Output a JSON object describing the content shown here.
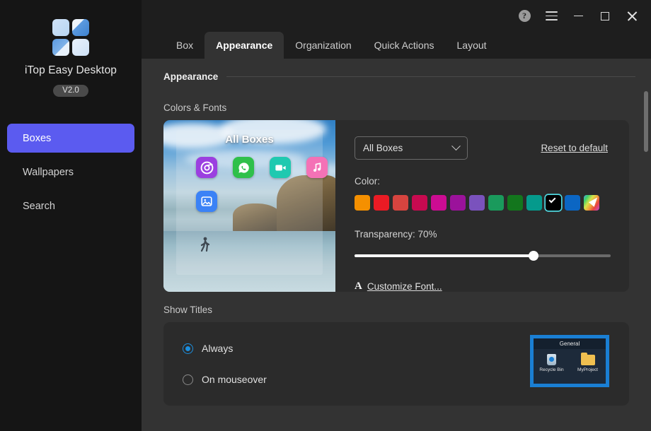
{
  "sidebar": {
    "app_name": "iTop Easy Desktop",
    "version": "V2.0",
    "logo_icon": "four-squares-logo-icon",
    "items": [
      {
        "label": "Boxes",
        "active": true
      },
      {
        "label": "Wallpapers",
        "active": false
      },
      {
        "label": "Search",
        "active": false
      }
    ]
  },
  "titlebar": {
    "help_label": "?",
    "help_icon": "help-circle-icon",
    "menu_icon": "hamburger-menu-icon",
    "minimize_icon": "minimize-icon",
    "maximize_icon": "maximize-icon",
    "close_icon": "close-icon"
  },
  "tabs": [
    {
      "label": "Box",
      "active": false
    },
    {
      "label": "Appearance",
      "active": true
    },
    {
      "label": "Organization",
      "active": false
    },
    {
      "label": "Quick Actions",
      "active": false
    },
    {
      "label": "Layout",
      "active": false
    }
  ],
  "content": {
    "section_title": "Appearance",
    "groups": {
      "colors_fonts": "Colors & Fonts",
      "show_titles": "Show Titles"
    }
  },
  "preview": {
    "box_title": "All Boxes",
    "apps": [
      {
        "name": "chrome-icon",
        "glyph": "◎",
        "color": "#9b3fe0"
      },
      {
        "name": "whatsapp-icon",
        "glyph": "✆",
        "color": "#2fc04a"
      },
      {
        "name": "video-icon",
        "glyph": "▶",
        "color": "#1fc9b0"
      },
      {
        "name": "music-icon",
        "glyph": "♫",
        "color": "#f472b6"
      },
      {
        "name": "photos-icon",
        "glyph": "▣",
        "color": "#3b82f6"
      }
    ]
  },
  "colors_panel": {
    "scope_select": {
      "value": "All Boxes",
      "options": [
        "All Boxes"
      ],
      "chevron_icon": "chevron-down-icon"
    },
    "reset_label": "Reset to default",
    "color_label": "Color:",
    "swatches": [
      {
        "hex": "#f59000",
        "selected": false
      },
      {
        "hex": "#ea1b24",
        "selected": false
      },
      {
        "hex": "#d6443f",
        "selected": false
      },
      {
        "hex": "#c80a50",
        "selected": false
      },
      {
        "hex": "#cc0c92",
        "selected": false
      },
      {
        "hex": "#9b129b",
        "selected": false
      },
      {
        "hex": "#7a52bd",
        "selected": false
      },
      {
        "hex": "#1a9a5c",
        "selected": false
      },
      {
        "hex": "#13761d",
        "selected": false
      },
      {
        "hex": "#059a8c",
        "selected": false
      },
      {
        "hex": "#000000",
        "selected": true
      },
      {
        "hex": "#0b66c3",
        "selected": false
      },
      {
        "hex": "rainbow",
        "selected": false
      }
    ],
    "transparency_label": "Transparency: 70%",
    "transparency_value": 70,
    "font_link": "Customize Font...",
    "font_icon": "letter-A-icon"
  },
  "show_titles": {
    "options": [
      {
        "label": "Always",
        "selected": true
      },
      {
        "label": "On mouseover",
        "selected": false
      }
    ],
    "mini_preview": {
      "title": "General",
      "items": [
        {
          "caption": "Recycle Bin",
          "icon": "recycle-bin-icon"
        },
        {
          "caption": "MyProject",
          "icon": "folder-icon"
        }
      ]
    }
  },
  "colors": {
    "accent": "#5b5bf0",
    "radio_accent": "#1b8fe0",
    "selected_swatch_border": "#4fd8e0"
  }
}
